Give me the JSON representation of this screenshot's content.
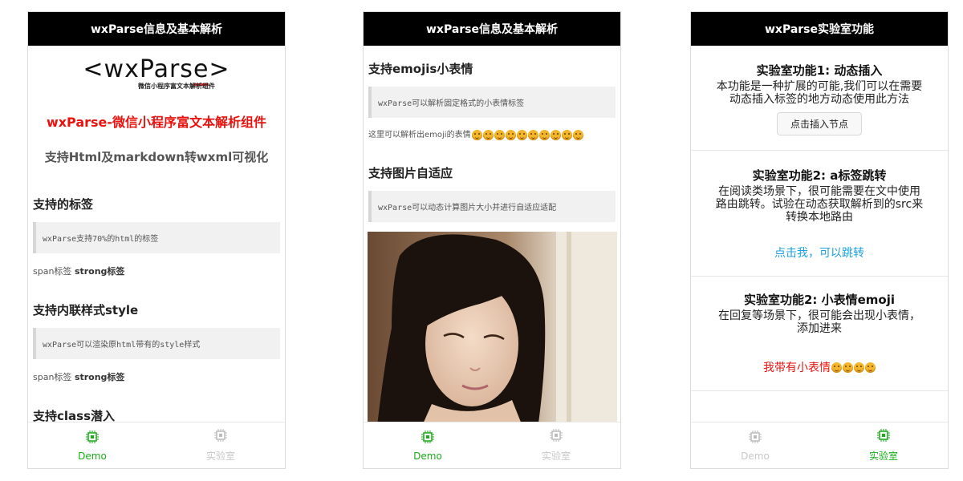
{
  "phone1": {
    "nav_title": "wxParse信息及基本解析",
    "logo_text_a": "<wxPars",
    "logo_text_b": "e",
    "logo_text_c": ">",
    "logo_subtitle": "微信小程序富文本解析组件",
    "headline_red": "wxParse-微信小程序富文本解析组件",
    "headline_grey": "支持Html及markdown转wxml可视化",
    "sections": [
      {
        "title": "支持的标签",
        "code": "wxParse支持70%的html的标签",
        "span": "span标签",
        "strong": "strong标签"
      },
      {
        "title": "支持内联样式style",
        "code": "wxParse可以渲染原html带有的style样式",
        "span": "span标签",
        "strong": "strong标签"
      },
      {
        "title": "支持class潜入"
      }
    ]
  },
  "phone2": {
    "nav_title": "wxParse信息及基本解析",
    "section1_title": "支持emojis小表情",
    "section1_code": "wxParse可以解析固定格式的小表情标签",
    "emoji_text": "这里可以解析出emoji的表情",
    "section2_title": "支持图片自适应",
    "section2_code": "wxParse可以动态计算图片大小并进行自适应适配"
  },
  "phone3": {
    "nav_title": "wxParse实验室功能",
    "lab1": {
      "title": "实验室功能1: 动态插入",
      "desc": "本功能是一种扩展的可能,我们可以在需要动态插入标签的地方动态使用此方法",
      "button": "点击插入节点"
    },
    "lab2": {
      "title": "实验室功能2: a标签跳转",
      "desc": "在阅读类场景下，很可能需要在文中使用路由跳转。试验在动态获取解析到的src来转换本地路由",
      "link": "点击我，可以跳转"
    },
    "lab3": {
      "title": "实验室功能2: 小表情emoji",
      "desc": "在回复等场景下，很可能会出现小表情，添加进来",
      "red_text": "我带有小表情"
    }
  },
  "tabs": {
    "demo": "Demo",
    "lab": "实验室"
  },
  "colors": {
    "active_tab": "#1aad19",
    "inactive_tab": "#c8c8c8",
    "headline_red": "#e8130f",
    "link_blue": "#1ba0e0",
    "nav_bg": "#000000"
  },
  "icons": {
    "tab_icon": "chip-icon",
    "emoji": "smiley-emoji-icon"
  }
}
